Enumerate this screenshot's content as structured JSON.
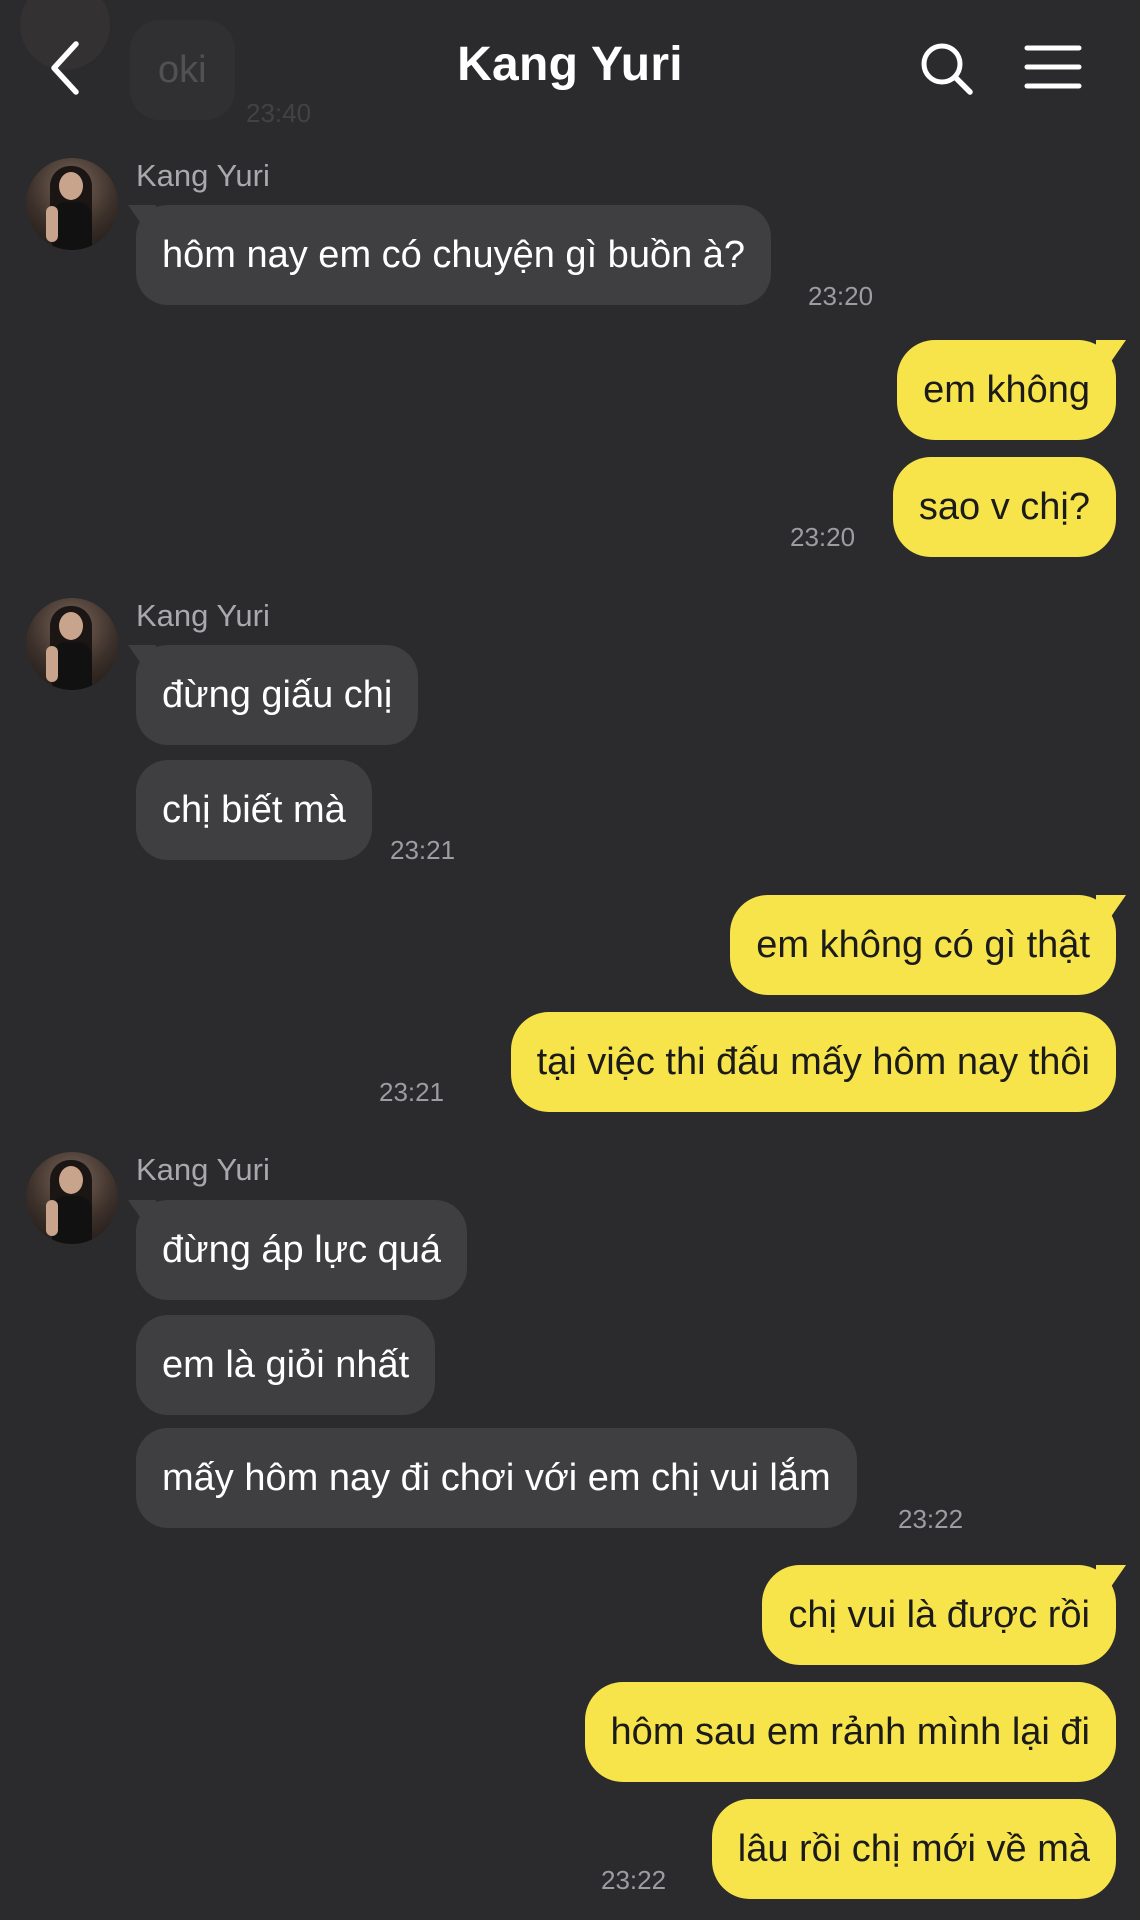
{
  "header": {
    "title": "Kang Yuri",
    "back_icon": "chevron-left-icon",
    "search_icon": "search-icon",
    "menu_icon": "hamburger-menu-icon"
  },
  "ghost": {
    "text": "oki",
    "time": "23:40"
  },
  "messages": {
    "g1": {
      "sender": "Kang Yuri",
      "m1": "hôm nay em có chuyện gì buồn à?",
      "time": "23:20"
    },
    "g2": {
      "m1": "em không",
      "m2": "sao v chị?",
      "time": "23:20"
    },
    "g3": {
      "sender": "Kang Yuri",
      "m1": "đừng giấu chị",
      "m2": "chị biết mà",
      "time": "23:21"
    },
    "g4": {
      "m1": "em không có gì thật",
      "m2": "tại việc thi đấu mấy hôm nay thôi",
      "time": "23:21"
    },
    "g5": {
      "sender": "Kang Yuri",
      "m1": "đừng áp lực quá",
      "m2": "em là giỏi nhất",
      "m3": "mấy hôm nay đi chơi với em chị vui lắm",
      "time": "23:22"
    },
    "g6": {
      "m1": "chị vui là được rồi",
      "m2": "hôm sau em rảnh mình lại đi",
      "m3": "lâu rồi chị mới về mà",
      "time": "23:22"
    }
  },
  "colors": {
    "background": "#2b2b2d",
    "incoming_bubble": "#3f3f42",
    "outgoing_bubble": "#f7e44a",
    "timestamp": "#9c9ca1"
  }
}
